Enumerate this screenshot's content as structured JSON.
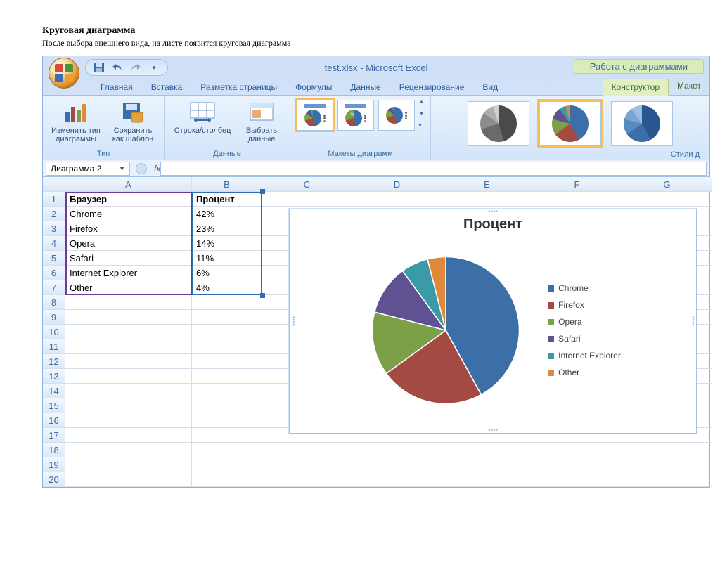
{
  "page": {
    "title": "Круговая диаграмма",
    "subtitle": "После выбора внешнего вида, на листе появится круговая диаграмма"
  },
  "titlebar": {
    "filename": "test.xlsx",
    "separator": " - ",
    "app": "Microsoft Excel",
    "context_tab_title": "Работа с диаграммами"
  },
  "tabs": {
    "main": [
      "Главная",
      "Вставка",
      "Разметка страницы",
      "Формулы",
      "Данные",
      "Рецензирование",
      "Вид"
    ],
    "context": [
      "Конструктор",
      "Макет"
    ],
    "active": "Конструктор"
  },
  "ribbon": {
    "group_type": {
      "label": "Тип",
      "change_type": "Изменить тип диаграммы",
      "save_template": "Сохранить как шаблон"
    },
    "group_data": {
      "label": "Данные",
      "switch": "Строка/столбец",
      "select": "Выбрать данные"
    },
    "group_layouts": {
      "label": "Макеты диаграмм"
    },
    "group_styles": {
      "label": "Стили д"
    }
  },
  "namebox": "Диаграмма 2",
  "fx_label": "fx",
  "columns": [
    "A",
    "B",
    "C",
    "D",
    "E",
    "F",
    "G"
  ],
  "rows": [
    1,
    2,
    3,
    4,
    5,
    6,
    7,
    8,
    9,
    10,
    11,
    12,
    13,
    14,
    15,
    16,
    17,
    18,
    19,
    20
  ],
  "table": {
    "headers": [
      "Браузер",
      "Процент"
    ],
    "rows": [
      [
        "Chrome",
        "42%"
      ],
      [
        "Firefox",
        "23%"
      ],
      [
        "Opera",
        "14%"
      ],
      [
        "Safari",
        "11%"
      ],
      [
        "Internet Explorer",
        "6%"
      ],
      [
        "Other",
        "4%"
      ]
    ]
  },
  "chart_data": {
    "type": "pie",
    "title": "Процент",
    "categories": [
      "Chrome",
      "Firefox",
      "Opera",
      "Safari",
      "Internet Explorer",
      "Other"
    ],
    "values": [
      42,
      23,
      14,
      11,
      6,
      4
    ],
    "colors": [
      "#3c6fa8",
      "#a34a42",
      "#7ba048",
      "#5f5192",
      "#3a9aa6",
      "#e0893a"
    ]
  }
}
